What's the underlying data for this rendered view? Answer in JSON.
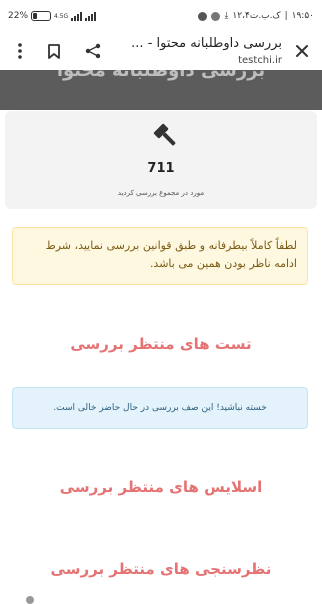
{
  "status_bar": {
    "time": "۱۹:۵۰",
    "date": "۱۲،۴ک.ب.ت",
    "battery_percent": "22%",
    "network_label": "4.5G"
  },
  "toolbar": {
    "title": "بررسی داوطلبانه محتوا - ...",
    "url": "testchi.ir"
  },
  "hero": {
    "text": "بررسی داوطلبانه محتوا"
  },
  "stats": {
    "count": "711",
    "label": "مورد در مجموع بررسی کردید"
  },
  "notice": {
    "text": "لطفاً کاملاً بیطرفانه و طبق قوانین بررسی نمایید، شرط ادامه ناظر بودن همین می باشد."
  },
  "sections": {
    "tests_title": "تست های منتظر بررسی",
    "empty_message": "خسته نباشید! این صف بررسی در حال حاضر خالی است.",
    "slides_title": "اسلایس های منتظر بررسی",
    "polls_title": "نظرسنجی های منتظر بررسی"
  },
  "icons": {
    "close": "close-icon",
    "bookmark": "bookmark-icon",
    "share": "share-icon",
    "menu": "more-vert-icon",
    "gavel": "gavel-icon"
  },
  "colors": {
    "section_title": "#e57373",
    "hero_bg": "#5c5c5c",
    "warn_bg": "#fff8e1",
    "info_bg": "#e3f2fb"
  }
}
